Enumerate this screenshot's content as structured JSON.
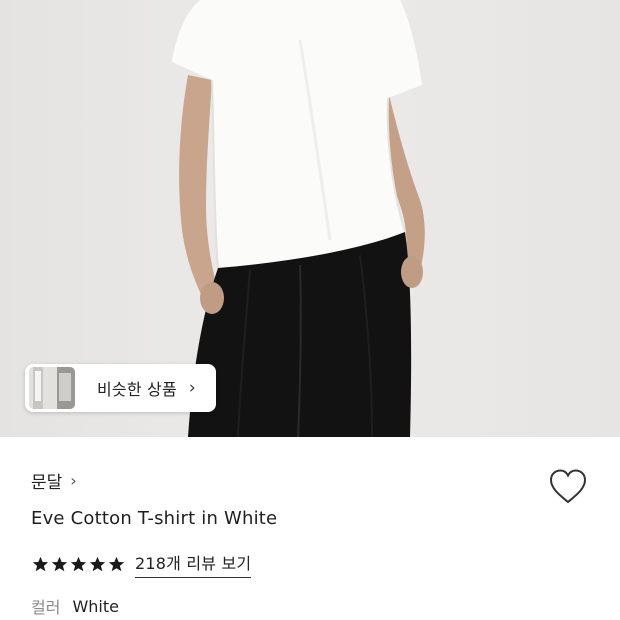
{
  "product_image": {
    "similar_products_label": "비슷한 상품",
    "similar_chevron": "›"
  },
  "product": {
    "brand": "문달",
    "brand_chevron": "›",
    "title": "Eve Cotton T-shirt in White",
    "rating_stars": 5,
    "review_link": "218개 리뷰 보기",
    "option_label": "컬러",
    "option_value": "White"
  },
  "icons": {
    "wishlist": "heart-outline-icon",
    "star": "star-filled-icon"
  },
  "colors": {
    "text": "#222222",
    "muted": "#8a8a8a",
    "background_photo": "#e9e8e6"
  }
}
